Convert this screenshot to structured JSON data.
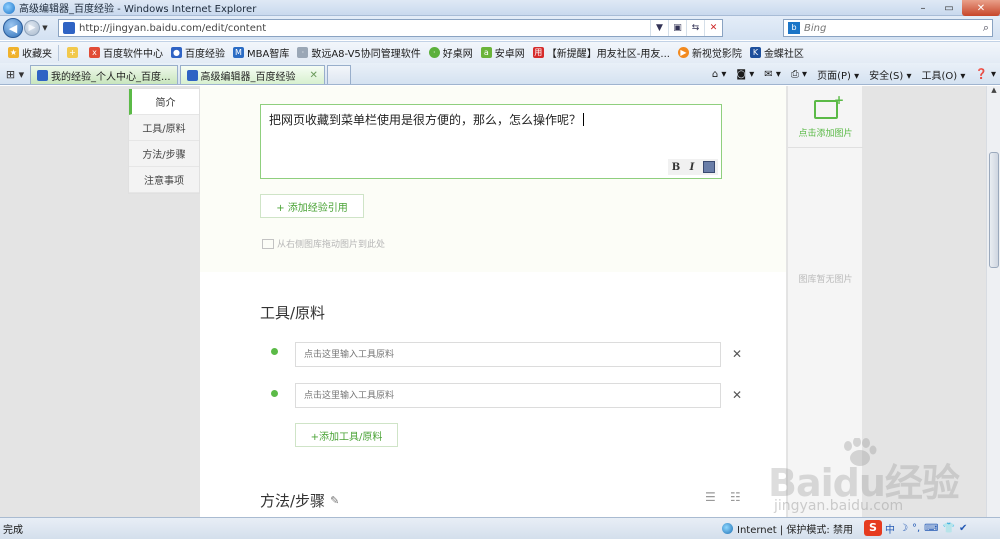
{
  "window": {
    "title": "高级编辑器_百度经验 - Windows Internet Explorer",
    "controls": [
      "–",
      "▭",
      "✕"
    ]
  },
  "address": {
    "url": "http://jingyan.baidu.com/edit/content",
    "search_placeholder": "Bing",
    "search_engine_icon": "bing-icon"
  },
  "favorites": {
    "label": "收藏夹",
    "items": [
      "百度软件中心",
      "百度经验",
      "MBA智库",
      "致远A8-V5协同管理软件",
      "好桌网",
      "安卓网",
      "【新提醒】用友社区-用友...",
      "新视觉影院",
      "金蝶社区"
    ]
  },
  "tabs": [
    {
      "label": "我的经验_个人中心_百度...",
      "active": false
    },
    {
      "label": "高级编辑器_百度经验",
      "active": true
    }
  ],
  "commands": [
    "页面(P) ▾",
    "安全(S) ▾",
    "工具(O) ▾"
  ],
  "leftnav": {
    "items": [
      "简介",
      "工具/原料",
      "方法/步骤",
      "注意事项"
    ]
  },
  "editor": {
    "text": "把网页收藏到菜单栏使用是很方便的，那么，怎么操作呢？",
    "tools": [
      "B",
      "I"
    ],
    "add_reference": "+ 添加经验引用",
    "drag_hint": "从右侧图库拖动图片到此处"
  },
  "tools_section": {
    "title": "工具/原料",
    "inputs": [
      {
        "placeholder": "点击这里输入工具原料"
      },
      {
        "placeholder": "点击这里输入工具原料"
      }
    ],
    "add_button": "+添加工具/原料"
  },
  "method_section": {
    "title": "方法/步骤"
  },
  "right_panel": {
    "add_image": "点击添加图片",
    "empty": "图库暂无图片"
  },
  "status": {
    "text": "完成",
    "zone": "Internet | 保护模式: 禁用",
    "ime_items": [
      "中",
      "☽",
      "°,",
      "⌨",
      "👕",
      "✔"
    ]
  },
  "watermark": {
    "brand": "Baidu经验",
    "url": "jingyan.baidu.com"
  },
  "colors": {
    "accent_green": "#5bba47",
    "ie_blue": "#2e6fb8",
    "intro_bg": "#fcfdf7"
  }
}
